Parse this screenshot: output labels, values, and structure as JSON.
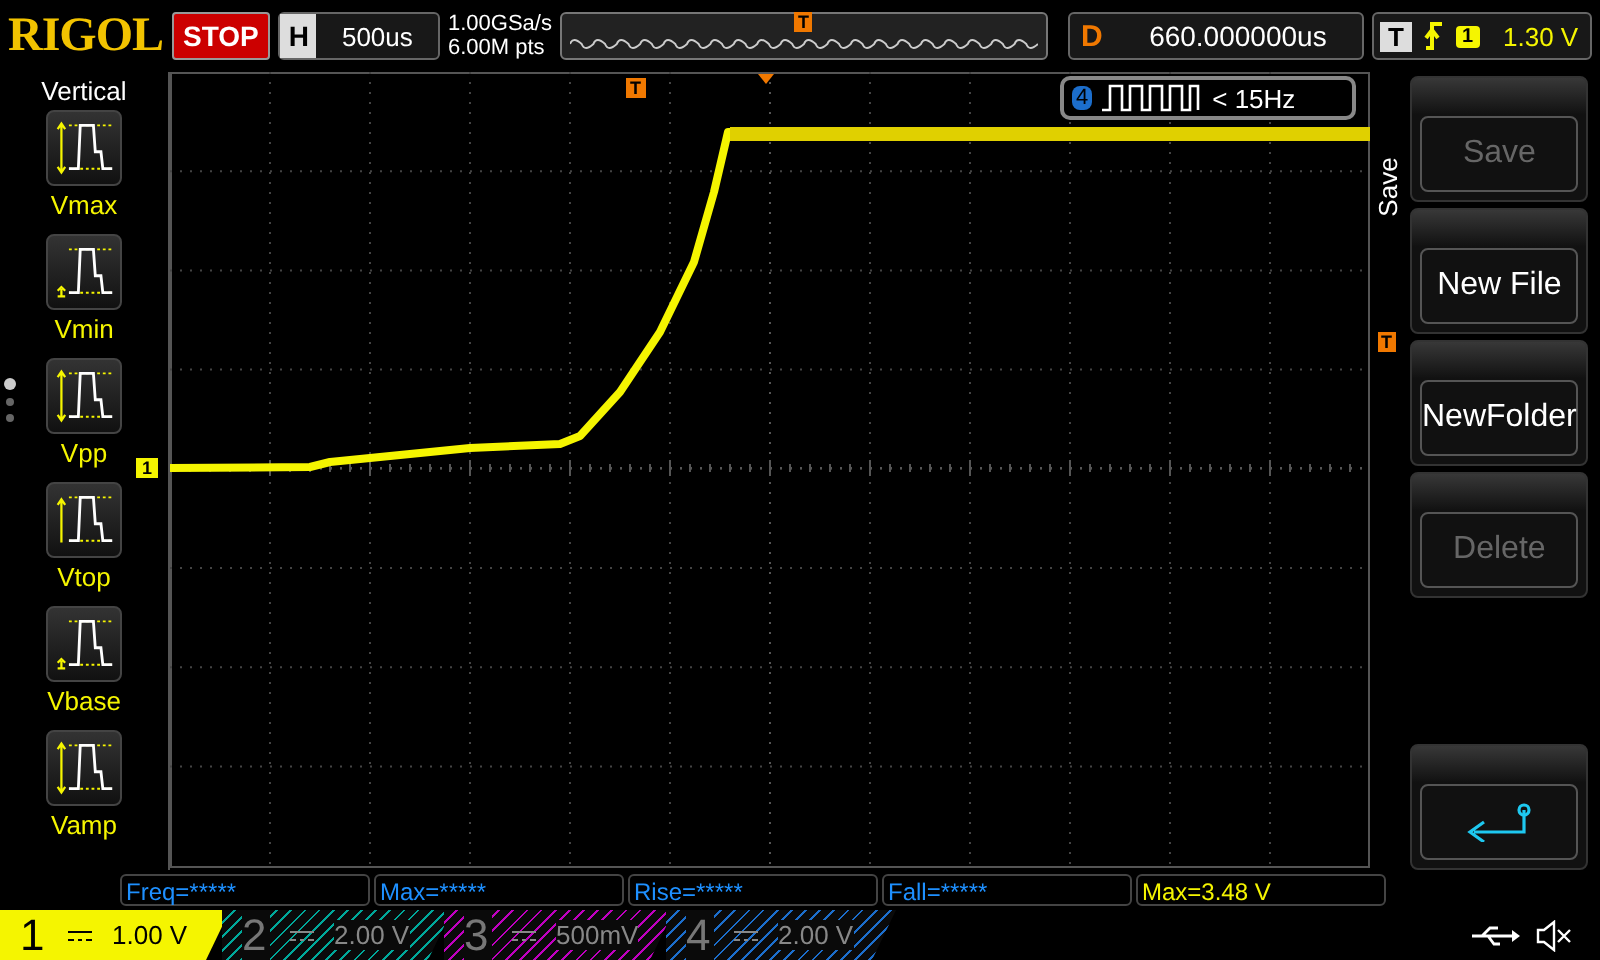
{
  "top_bar": {
    "logo": "RIGOL",
    "run_state": "STOP",
    "horizontal": {
      "label": "H",
      "value": "500us"
    },
    "sample_rate": "1.00GSa/s",
    "memory_depth": "6.00M pts",
    "memory_marker": "T",
    "delay": {
      "label": "D",
      "value": "660.000000us"
    },
    "trigger": {
      "label": "T",
      "source": "1",
      "level": "1.30 V"
    }
  },
  "measure_menu": {
    "title": "Vertical",
    "items": [
      {
        "label": "Vmax"
      },
      {
        "label": "Vmin"
      },
      {
        "label": "Vpp"
      },
      {
        "label": "Vtop"
      },
      {
        "label": "Vbase"
      },
      {
        "label": "Vamp"
      }
    ],
    "page_dots": [
      {
        "selected": true
      },
      {
        "selected": false
      },
      {
        "selected": false
      }
    ]
  },
  "plot": {
    "trigger_marker": "T",
    "channel_marker": "1",
    "right_trigger_marker": "T",
    "trigger_info": {
      "source": "4",
      "condition": "< 15Hz"
    }
  },
  "softkeys": {
    "title": "Save",
    "items": [
      {
        "kind": "text",
        "label": "Save",
        "disabled": true
      },
      {
        "kind": "text",
        "label": "New File",
        "disabled": false
      },
      {
        "kind": "text",
        "label": "NewFolder",
        "disabled": false
      },
      {
        "kind": "text",
        "label": "Delete",
        "disabled": true
      },
      {
        "kind": "back",
        "disabled": false
      }
    ]
  },
  "measurements": [
    {
      "text": "Freq=*****",
      "color": "#1e90ff"
    },
    {
      "text": "Max=*****",
      "color": "#1e90ff"
    },
    {
      "text": "Rise=*****",
      "color": "#1e90ff"
    },
    {
      "text": "Fall=*****",
      "color": "#1e90ff"
    },
    {
      "text": "Max=3.48 V",
      "color": "#f5f500"
    }
  ],
  "channels": [
    {
      "number": "1",
      "scale": "1.00 V",
      "selected": true,
      "color": "#f5f500"
    },
    {
      "number": "2",
      "scale": "2.00 V",
      "selected": false,
      "color": "#00a89a"
    },
    {
      "number": "3",
      "scale": "500mV",
      "selected": false,
      "color": "#c000c0"
    },
    {
      "number": "4",
      "scale": "2.00 V",
      "selected": false,
      "color": "#1c6ecc"
    }
  ]
}
